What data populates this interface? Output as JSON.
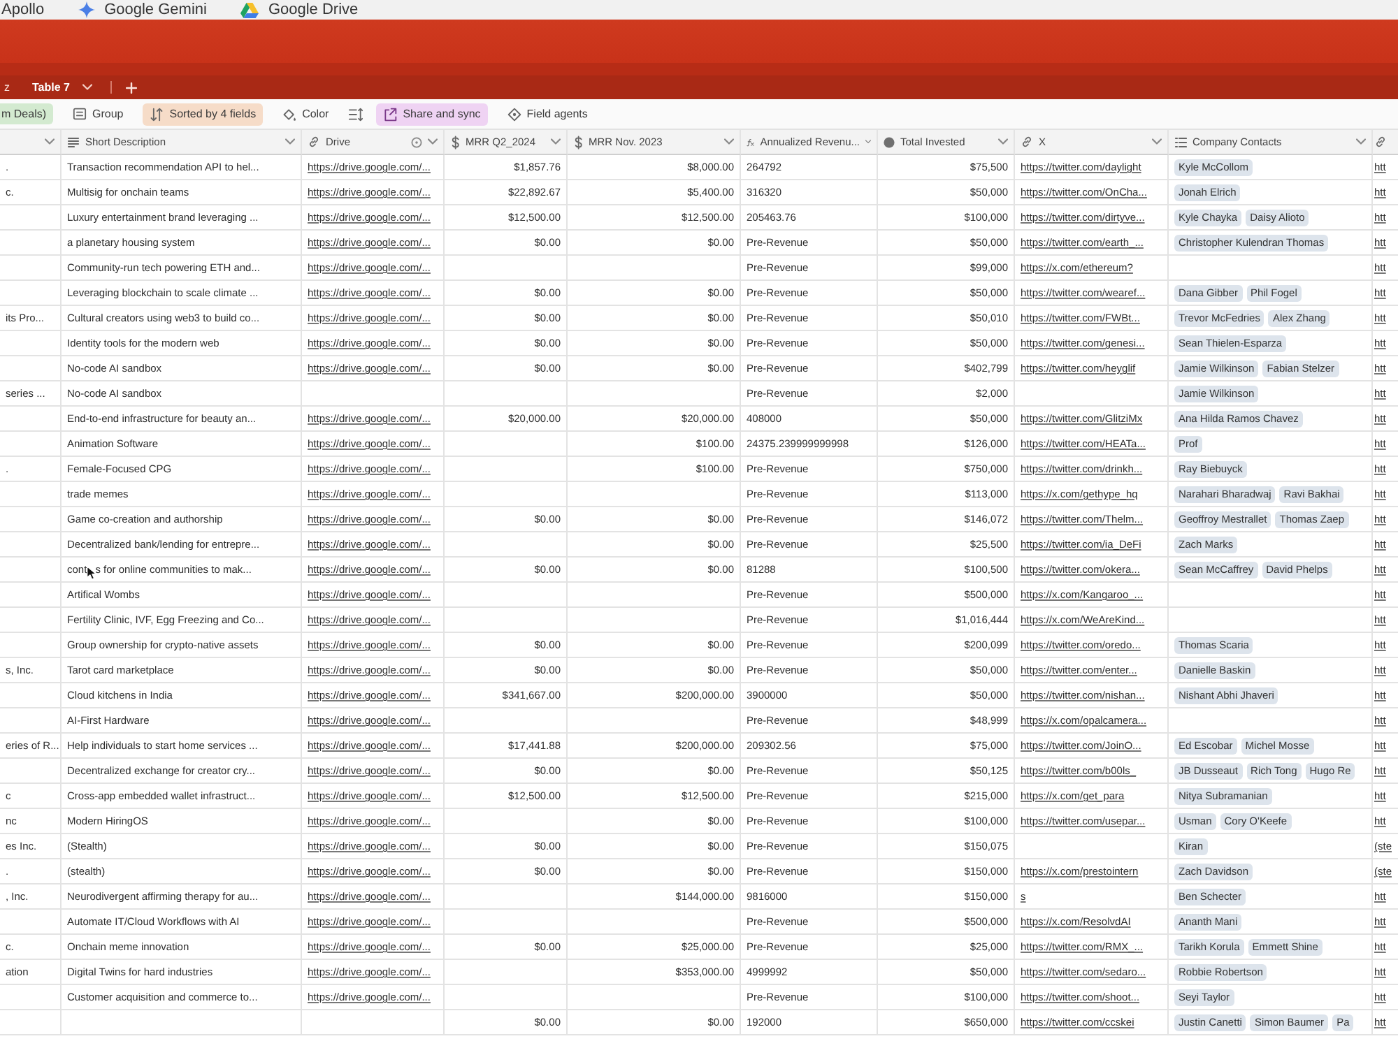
{
  "bookmarks": [
    {
      "label": "Apollo",
      "kind": "none"
    },
    {
      "label": "Google Gemini",
      "kind": "sparkle"
    },
    {
      "label": "Google Drive",
      "kind": "drive"
    }
  ],
  "tabs": [
    {
      "label": "z",
      "selected": false
    },
    {
      "label": "Table 7",
      "selected": true
    }
  ],
  "toolbar": [
    {
      "label": "m Deals)",
      "kind": "view",
      "color": "#d3ead0"
    },
    {
      "label": "Group",
      "kind": "group"
    },
    {
      "label": "Sorted by 4 fields",
      "kind": "sort",
      "color": "#f6dcc8"
    },
    {
      "label": "Color",
      "kind": "color"
    },
    {
      "kind": "row_height"
    },
    {
      "label": "Share and sync",
      "kind": "share",
      "color": "#efd3f3"
    },
    {
      "label": "Field agents",
      "kind": "agents"
    }
  ],
  "grid": {
    "columns": [
      {
        "kind": "text"
      },
      {
        "label": "Short Description",
        "kind": "long_text"
      },
      {
        "label": "Drive",
        "kind": "url",
        "info": true
      },
      {
        "label": "MRR Q2_2024",
        "kind": "currency"
      },
      {
        "label": "MRR Nov. 2023",
        "kind": "currency"
      },
      {
        "label": "Annualized Revenu...",
        "kind": "formula"
      },
      {
        "label": "Total Invested",
        "kind": "rollup"
      },
      {
        "label": "X",
        "kind": "url"
      },
      {
        "label": "Company Contacts",
        "kind": "linked"
      },
      {
        "kind": "url"
      }
    ],
    "rows": [
      [
        ".",
        "Transaction recommendation API to hel...",
        "https://drive.google.com/...",
        "$1,857.76",
        "$8,000.00",
        "264792",
        "$75,500",
        "https://twitter.com/daylight",
        [
          "Kyle McCollom"
        ],
        "htt"
      ],
      [
        "c.",
        "Multisig for onchain teams",
        "https://drive.google.com/...",
        "$22,892.67",
        "$5,400.00",
        "316320",
        "$50,000",
        "https://twitter.com/OnCha...",
        [
          "Jonah Elrich"
        ],
        "htt"
      ],
      [
        null,
        "Luxury entertainment brand leveraging ...",
        "https://drive.google.com/...",
        "$12,500.00",
        "$12,500.00",
        "205463.76",
        "$100,000",
        "https://twitter.com/dirtyve...",
        [
          "Kyle Chayka",
          "Daisy Alioto"
        ],
        "htt"
      ],
      [
        null,
        "a planetary housing system",
        "https://drive.google.com/...",
        "$0.00",
        "$0.00",
        "Pre-Revenue",
        "$50,000",
        "https://twitter.com/earth_...",
        [
          "Christopher Kulendran Thomas"
        ],
        "htt"
      ],
      [
        null,
        "Community-run tech powering ETH and...",
        "https://drive.google.com/...",
        null,
        null,
        "Pre-Revenue",
        "$99,000",
        "https://x.com/ethereum?",
        null,
        "htt"
      ],
      [
        null,
        "Leveraging blockchain to scale climate ...",
        "https://drive.google.com/...",
        "$0.00",
        "$0.00",
        "Pre-Revenue",
        "$50,000",
        "https://twitter.com/wearef...",
        [
          "Dana Gibber",
          "Phil Fogel"
        ],
        "htt"
      ],
      [
        "its Pro...",
        "Cultural creators using web3 to build co...",
        "https://drive.google.com/...",
        "$0.00",
        "$0.00",
        "Pre-Revenue",
        "$50,010",
        "https://twitter.com/FWBt...",
        [
          "Trevor McFedries",
          "Alex Zhang"
        ],
        "htt"
      ],
      [
        null,
        "Identity tools for the modern web",
        "https://drive.google.com/...",
        "$0.00",
        "$0.00",
        "Pre-Revenue",
        "$50,000",
        "https://twitter.com/genesi...",
        [
          "Sean Thielen-Esparza"
        ],
        "htt"
      ],
      [
        null,
        "No-code AI sandbox",
        "https://drive.google.com/...",
        "$0.00",
        "$0.00",
        "Pre-Revenue",
        "$402,799",
        "https://twitter.com/heyglif",
        [
          "Jamie Wilkinson",
          "Fabian Stelzer"
        ],
        "htt"
      ],
      [
        "series ...",
        "No-code AI sandbox",
        null,
        null,
        null,
        "Pre-Revenue",
        "$2,000",
        null,
        [
          "Jamie Wilkinson"
        ],
        "htt"
      ],
      [
        null,
        "End-to-end infrastructure for beauty an...",
        "https://drive.google.com/...",
        "$20,000.00",
        "$20,000.00",
        "408000",
        "$50,000",
        "https://twitter.com/GlitziMx",
        [
          "Ana Hilda Ramos Chavez"
        ],
        "htt"
      ],
      [
        null,
        "Animation Software",
        "https://drive.google.com/...",
        null,
        "$100.00",
        "24375.239999999998",
        "$126,000",
        "https://twitter.com/HEATa...",
        [
          "Prof"
        ],
        "htt"
      ],
      [
        ".",
        "Female-Focused CPG",
        "https://drive.google.com/...",
        null,
        "$100.00",
        "Pre-Revenue",
        "$750,000",
        "https://twitter.com/drinkh...",
        [
          "Ray Biebuyck"
        ],
        "htt"
      ],
      [
        null,
        "trade memes",
        "https://drive.google.com/...",
        null,
        null,
        "Pre-Revenue",
        "$113,000",
        "https://x.com/gethype_hq",
        [
          "Narahari Bharadwaj",
          "Ravi Bakhai"
        ],
        "htt"
      ],
      [
        null,
        "Game co-creation and authorship",
        "https://drive.google.com/...",
        "$0.00",
        "$0.00",
        "Pre-Revenue",
        "$146,072",
        "https://twitter.com/Thelm...",
        [
          "Geoffroy Mestrallet",
          "Thomas Zaep"
        ],
        "htt"
      ],
      [
        null,
        "Decentralized bank/lending for entrepre...",
        "https://drive.google.com/...",
        null,
        "$0.00",
        "Pre-Revenue",
        "$25,500",
        "https://twitter.com/ia_DeFi",
        [
          "Zach Marks"
        ],
        "htt"
      ],
      [
        null,
        {
          "before_pointer": "cont",
          "after_pointer": "s for online communities to mak..."
        },
        "https://drive.google.com/...",
        "$0.00",
        "$0.00",
        "81288",
        "$100,500",
        "https://twitter.com/okera...",
        [
          "Sean McCaffrey",
          "David Phelps"
        ],
        "htt"
      ],
      [
        null,
        "Artifical Wombs",
        "https://drive.google.com/...",
        null,
        null,
        "Pre-Revenue",
        "$500,000",
        "https://x.com/Kangaroo_...",
        null,
        "htt"
      ],
      [
        null,
        "Fertility Clinic, IVF, Egg Freezing and Co...",
        "https://drive.google.com/...",
        null,
        null,
        "Pre-Revenue",
        "$1,016,444",
        "https://x.com/WeAreKind...",
        null,
        "htt"
      ],
      [
        null,
        "Group ownership for crypto-native assets",
        "https://drive.google.com/...",
        "$0.00",
        "$0.00",
        "Pre-Revenue",
        "$200,099",
        "https://twitter.com/oredo...",
        [
          "Thomas Scaria"
        ],
        "htt"
      ],
      [
        "s, Inc.",
        "Tarot card marketplace",
        "https://drive.google.com/...",
        "$0.00",
        "$0.00",
        "Pre-Revenue",
        "$50,000",
        "https://twitter.com/enter...",
        [
          "Danielle Baskin"
        ],
        "htt"
      ],
      [
        null,
        "Cloud kitchens in India",
        "https://drive.google.com/...",
        "$341,667.00",
        "$200,000.00",
        "3900000",
        "$50,000",
        "https://twitter.com/nishan...",
        [
          "Nishant Abhi Jhaveri"
        ],
        "htt"
      ],
      [
        null,
        "AI-First Hardware",
        "https://drive.google.com/...",
        null,
        null,
        "Pre-Revenue",
        "$48,999",
        "https://x.com/opalcamera...",
        null,
        "htt"
      ],
      [
        "eries of R...",
        "Help individuals to start home services ...",
        "https://drive.google.com/...",
        "$17,441.88",
        "$200,000.00",
        "209302.56",
        "$75,000",
        "https://twitter.com/JoinO...",
        [
          "Ed Escobar",
          "Michel Mosse"
        ],
        "htt"
      ],
      [
        null,
        "Decentralized exchange for creator cry...",
        "https://drive.google.com/...",
        "$0.00",
        "$0.00",
        "Pre-Revenue",
        "$50,125",
        "https://twitter.com/b00ls_",
        [
          "JB Dusseaut",
          "Rich Tong",
          "Hugo Re"
        ],
        "htt"
      ],
      [
        "c",
        "Cross-app embedded wallet infrastruct...",
        "https://drive.google.com/...",
        "$12,500.00",
        "$12,500.00",
        "Pre-Revenue",
        "$215,000",
        "https://x.com/get_para",
        [
          "Nitya Subramanian"
        ],
        "htt"
      ],
      [
        "nc",
        "Modern HiringOS",
        "https://drive.google.com/...",
        null,
        "$0.00",
        "Pre-Revenue",
        "$100,000",
        "https://twitter.com/usepar...",
        [
          "Usman",
          "Cory O'Keefe"
        ],
        "htt"
      ],
      [
        "es Inc.",
        "(Stealth)",
        "https://drive.google.com/...",
        "$0.00",
        "$0.00",
        "Pre-Revenue",
        "$150,075",
        null,
        [
          "Kiran"
        ],
        "(ste"
      ],
      [
        ".",
        "(stealth)",
        "https://drive.google.com/...",
        "$0.00",
        "$0.00",
        "Pre-Revenue",
        "$150,000",
        "https://x.com/prestointern",
        [
          "Zach Davidson"
        ],
        "(ste"
      ],
      [
        ", Inc.",
        "Neurodivergent affirming therapy for au...",
        "https://drive.google.com/...",
        null,
        "$144,000.00",
        "9816000",
        "$150,000",
        "s",
        [
          "Ben Schecter"
        ],
        "htt"
      ],
      [
        null,
        "Automate IT/Cloud Workflows with AI",
        "https://drive.google.com/...",
        null,
        null,
        "Pre-Revenue",
        "$500,000",
        "https://x.com/ResolvdAI",
        [
          "Ananth Mani"
        ],
        "htt"
      ],
      [
        "c.",
        "Onchain meme innovation",
        "https://drive.google.com/...",
        "$0.00",
        "$25,000.00",
        "Pre-Revenue",
        "$25,000",
        "https://twitter.com/RMX_...",
        [
          "Tarikh Korula",
          "Emmett Shine"
        ],
        "htt"
      ],
      [
        "ation",
        "Digital Twins for hard industries",
        "https://drive.google.com/...",
        null,
        "$353,000.00",
        "4999992",
        "$50,000",
        "https://twitter.com/sedaro...",
        [
          "Robbie Robertson"
        ],
        "htt"
      ],
      [
        null,
        "Customer acquisition and commerce to...",
        "https://drive.google.com/...",
        null,
        null,
        "Pre-Revenue",
        "$100,000",
        "https://twitter.com/shoot...",
        [
          "Seyi Taylor"
        ],
        "htt"
      ],
      [
        null,
        null,
        null,
        "$0.00",
        "$0.00",
        "192000",
        "$650,000",
        "https://twitter.com/ccskei",
        [
          "Justin Canetti",
          "Simon Baumer",
          "Pa"
        ],
        "htt"
      ]
    ]
  }
}
